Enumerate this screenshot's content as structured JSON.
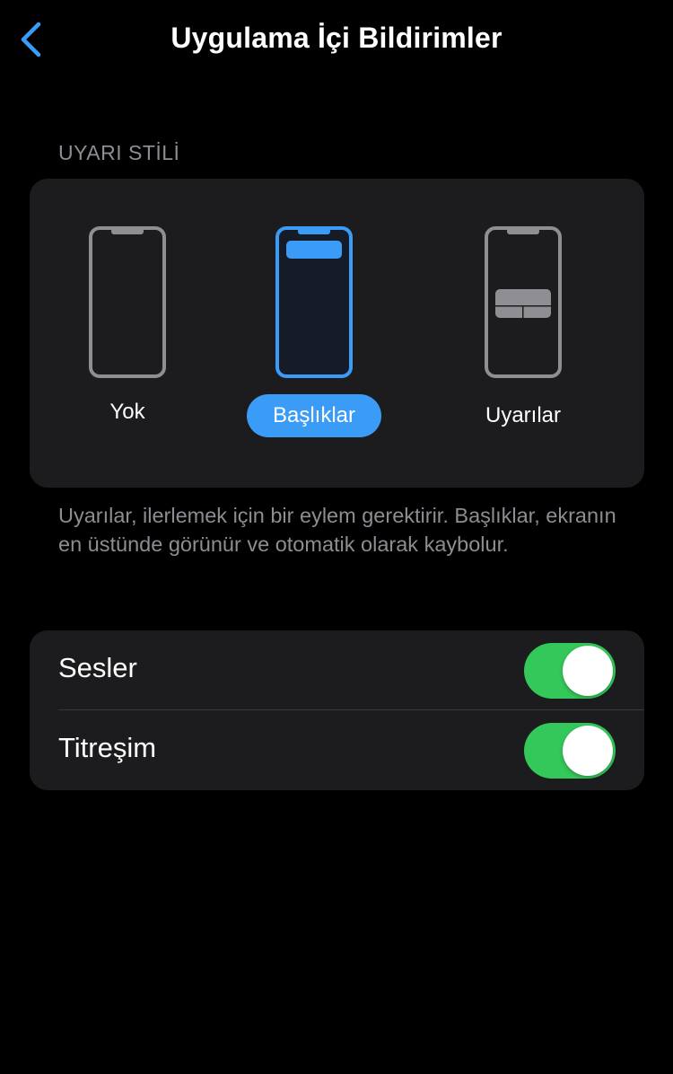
{
  "nav": {
    "title": "Uygulama İçi Bildirimler",
    "back_icon": "chevron-left-icon"
  },
  "alert_style": {
    "header": "UYARI STİLİ",
    "options": [
      {
        "label": "Yok",
        "selected": false
      },
      {
        "label": "Başlıklar",
        "selected": true
      },
      {
        "label": "Uyarılar",
        "selected": false
      }
    ],
    "description": "Uyarılar, ilerlemek için bir eylem gerektirir. Başlıklar, ekranın en üstünde görünür ve otomatik olarak kaybolur."
  },
  "toggles": [
    {
      "label": "Sesler",
      "on": true
    },
    {
      "label": "Titreşim",
      "on": true
    }
  ],
  "colors": {
    "accent": "#3a9cf7",
    "switch_on": "#34c759",
    "card_bg": "#1c1c1e",
    "secondary_text": "#8d8d93"
  }
}
